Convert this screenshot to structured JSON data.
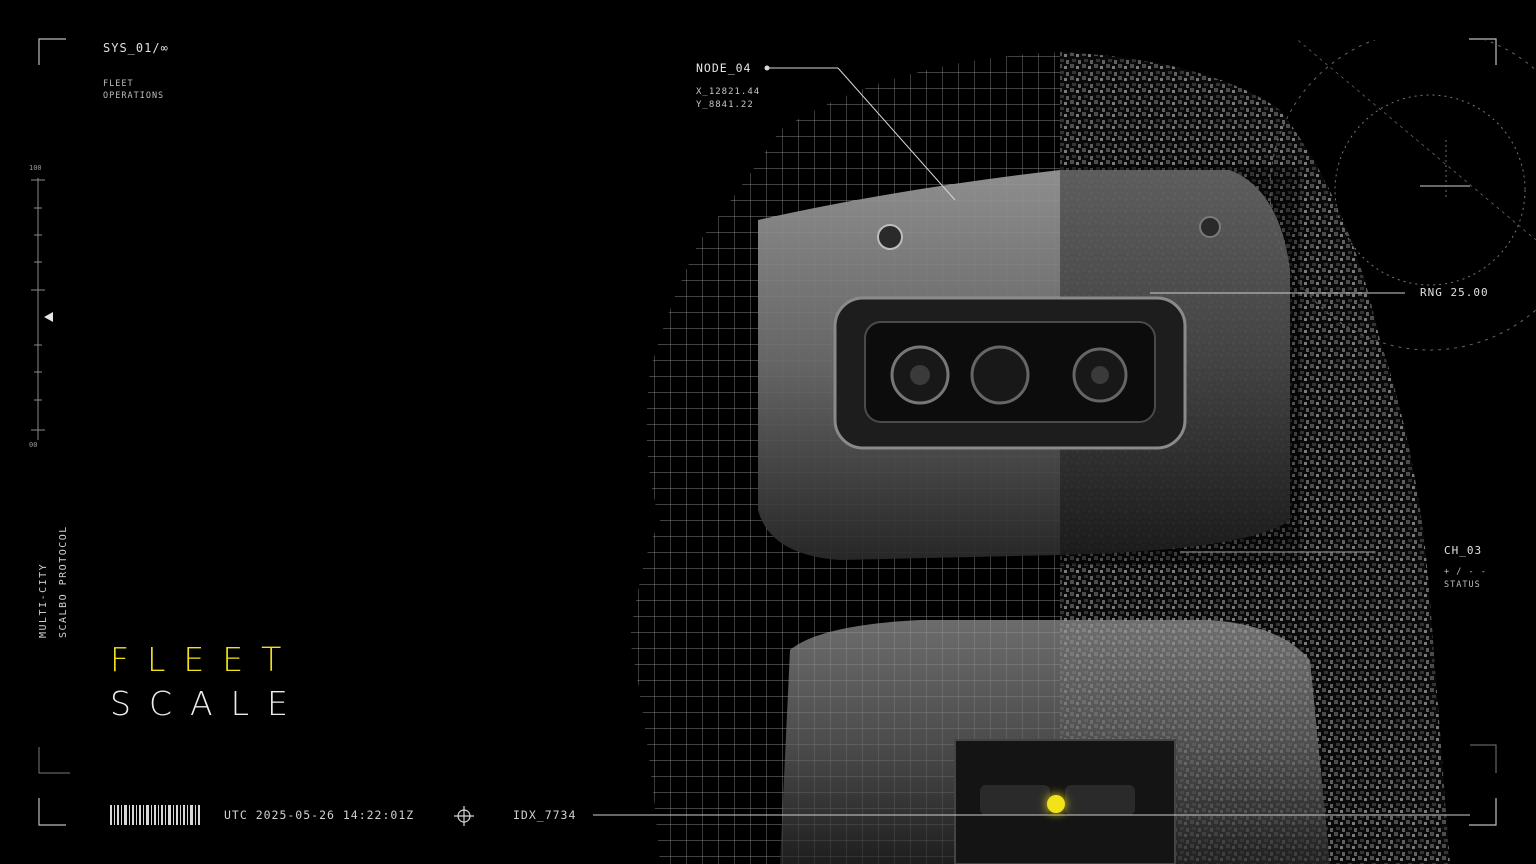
{
  "header": {
    "system_label": "SYS_01/∞",
    "section_lines": [
      "FLEET",
      "OPERATIONS"
    ]
  },
  "side": {
    "scale_top": "100",
    "scale_bottom": "00",
    "vertical_lines": [
      "MULTI-CITY",
      "SCALBO PROTOCOL"
    ]
  },
  "title": {
    "line1": "FLEET",
    "line2": "SCALE",
    "accent_color": "#f2e21a"
  },
  "footer": {
    "timestamp": "UTC 2025-05-26 14:22:01Z",
    "index": "IDX_7734",
    "barcode_icon": "barcode-icon",
    "target_icon": "crosshair-icon"
  },
  "callouts": {
    "node": {
      "label": "NODE_04",
      "coords": [
        "X_12821.44",
        "Y_8841.22"
      ]
    },
    "range": "RNG 25.00",
    "channel": {
      "label": "CH_03",
      "lines": [
        "+ / - -",
        "STATUS"
      ]
    }
  },
  "status_dot_color": "#f2e21a"
}
